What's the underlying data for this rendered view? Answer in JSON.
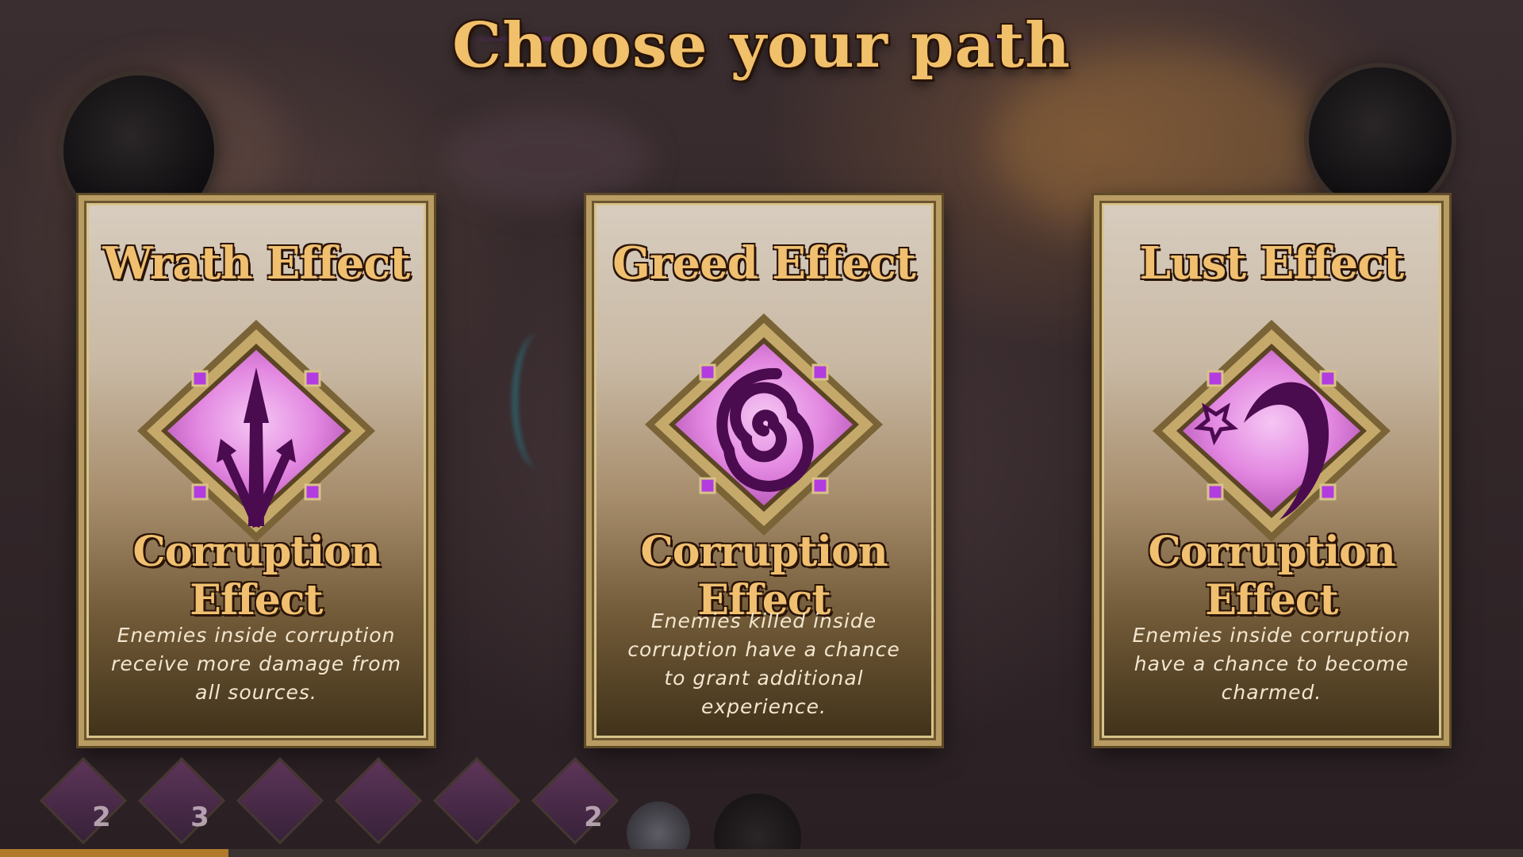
{
  "title": "Choose your path",
  "cards": [
    {
      "title": "Wrath Effect",
      "subtitle": "Corruption Effect",
      "description": "Enemies inside corruption receive more damage from all sources.",
      "icon": "triple-arrow-icon"
    },
    {
      "title": "Greed Effect",
      "subtitle": "Corruption Effect",
      "description": "Enemies killed inside corruption have a chance to grant additional experience.",
      "icon": "spiral-icon"
    },
    {
      "title": "Lust Effect",
      "subtitle": "Corruption Effect",
      "description": "Enemies inside corruption have a chance to become charmed.",
      "icon": "star-crescent-icon"
    }
  ],
  "hotbar": {
    "counts": [
      "2",
      "3",
      "2"
    ]
  },
  "colors": {
    "accent_gold": "#f0c070",
    "emblem_pink": "#e78ae6",
    "emblem_purple": "#4a0b4f",
    "frame_gold": "#b89c62"
  }
}
